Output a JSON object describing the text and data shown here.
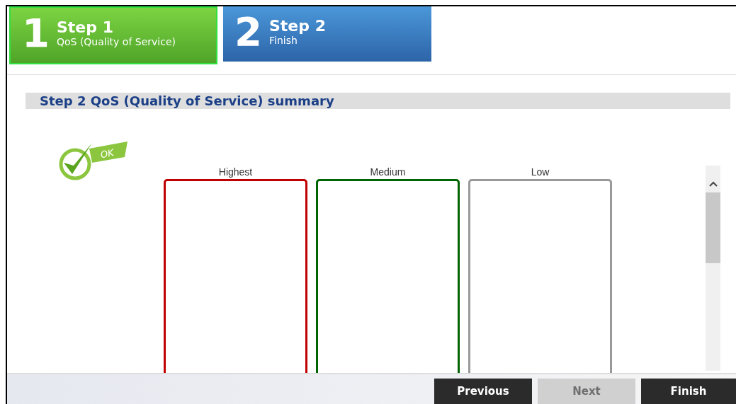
{
  "steps": [
    {
      "number": "1",
      "title": "Step 1",
      "subtitle": "QoS (Quality of Service)",
      "selected": true
    },
    {
      "number": "2",
      "title": "Step 2",
      "subtitle": "Finish",
      "selected": false
    }
  ],
  "section_title": "Step 2 QoS (Quality of Service) summary",
  "status_badge": {
    "label": "OK"
  },
  "priority_columns": [
    {
      "label": "Highest",
      "color": "#c00000"
    },
    {
      "label": "Medium",
      "color": "#006400"
    },
    {
      "label": "Low",
      "color": "#999999"
    }
  ],
  "buttons": [
    {
      "label": "Previous",
      "disabled": false
    },
    {
      "label": "Next",
      "disabled": true
    },
    {
      "label": "Finish",
      "disabled": false
    }
  ]
}
